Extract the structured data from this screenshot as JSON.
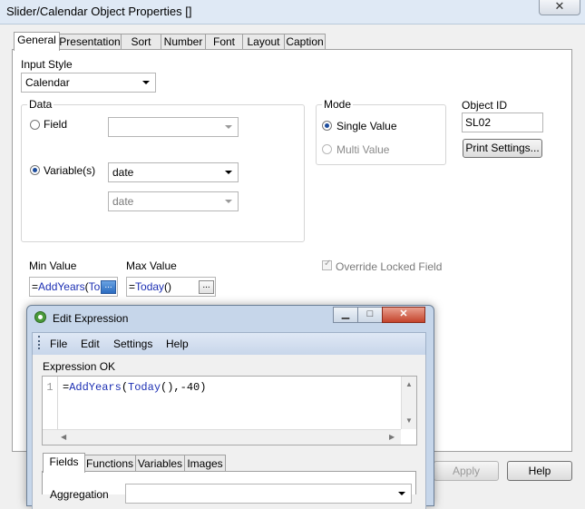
{
  "window": {
    "title": "Slider/Calendar Object Properties []",
    "close_glyph": "✕"
  },
  "tabs": [
    "General",
    "Presentation",
    "Sort",
    "Number",
    "Font",
    "Layout",
    "Caption"
  ],
  "general": {
    "input_style_label": "Input Style",
    "input_style_value": "Calendar",
    "data_group_label": "Data",
    "field_label": "Field",
    "variables_label": "Variable(s)",
    "variable_value": "date",
    "variable2_value": "date",
    "mode_group_label": "Mode",
    "single_value_label": "Single Value",
    "multi_value_label": "Multi Value",
    "object_id_label": "Object ID",
    "object_id_value": "SL02",
    "print_settings_label": "Print Settings...",
    "min_value_label": "Min Value",
    "min_value_text": "=AddYears(To",
    "max_value_label": "Max Value",
    "max_value_text": "=Today()",
    "override_label": "Override Locked Field",
    "ellipsis": "..."
  },
  "footer": {
    "apply_label": "Apply",
    "help_label": "Help"
  },
  "edit_expression": {
    "title": "Edit Expression",
    "menu": [
      "File",
      "Edit",
      "Settings",
      "Help"
    ],
    "status": "Expression OK",
    "line_number": "1",
    "code_eq": "=",
    "code_fn1": "AddYears",
    "code_paren": "(",
    "code_fn2": "Today",
    "code_rest": "(),-40)",
    "bottom_tabs": [
      "Fields",
      "Functions",
      "Variables",
      "Images"
    ],
    "aggregation_label": "Aggregation"
  }
}
